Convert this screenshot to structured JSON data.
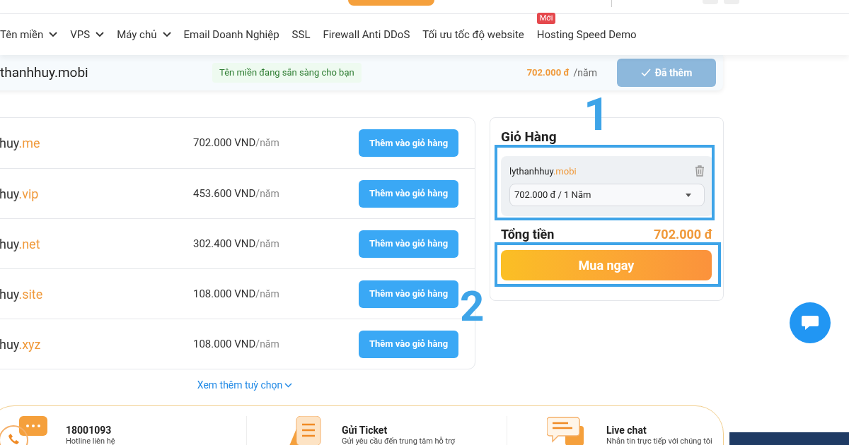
{
  "nav": {
    "items": [
      {
        "label": "Tên miền",
        "dropdown": true
      },
      {
        "label": "VPS",
        "dropdown": true
      },
      {
        "label": "Máy chủ",
        "dropdown": true
      },
      {
        "label": "Email Doanh Nghiệp",
        "dropdown": false
      },
      {
        "label": "SSL",
        "dropdown": false
      },
      {
        "label": "Firewall Anti DDoS",
        "dropdown": false
      },
      {
        "label": "Tối ưu tốc độ website",
        "dropdown": false
      },
      {
        "label": "Hosting Speed Demo",
        "dropdown": false,
        "badge": "Mới"
      }
    ]
  },
  "search_result": {
    "domain": "thanhhuy.mobi",
    "status": "Tên miền đang sẵn sàng cho bạn",
    "price": "702.000 đ",
    "period": "/năm",
    "button": "Đã thêm",
    "added": true
  },
  "suggestions": {
    "rows": [
      {
        "name": "huy",
        "tld": ".me",
        "price": "702.000 VND",
        "period": "/năm",
        "button": "Thêm vào giỏ hàng"
      },
      {
        "name": "huy",
        "tld": ".vip",
        "price": "453.600 VND",
        "period": "/năm",
        "button": "Thêm vào giỏ hàng"
      },
      {
        "name": "huy",
        "tld": ".net",
        "price": "302.400 VND",
        "period": "/năm",
        "button": "Thêm vào giỏ hàng"
      },
      {
        "name": "huy",
        "tld": ".site",
        "price": "108.000 VND",
        "period": "/năm",
        "button": "Thêm vào giỏ hàng"
      },
      {
        "name": "huy",
        "tld": ".xyz",
        "price": "108.000 VND",
        "period": "/năm",
        "button": "Thêm vào giỏ hàng"
      }
    ],
    "more_link": "Xem thêm tuỳ chọn"
  },
  "cart": {
    "title": "Giỏ Hàng",
    "item": {
      "name": "lythanhhuy",
      "tld": ".mobi",
      "option": "702.000 đ / 1 Năm"
    },
    "total_label": "Tổng tiền",
    "total": "702.000 đ",
    "buy_button": "Mua ngay"
  },
  "annotations": [
    "1",
    "2"
  ],
  "support": [
    {
      "kind": "phone",
      "title": "18001093",
      "subtitle": "Hotline liên hệ"
    },
    {
      "kind": "ticket",
      "title": "Gửi Ticket",
      "subtitle": "Gửi yêu cầu đến trung tâm hỗ trợ"
    },
    {
      "kind": "chat",
      "title": "Live chat",
      "subtitle": "Nhắn tin trực tiếp với chúng tôi"
    }
  ]
}
